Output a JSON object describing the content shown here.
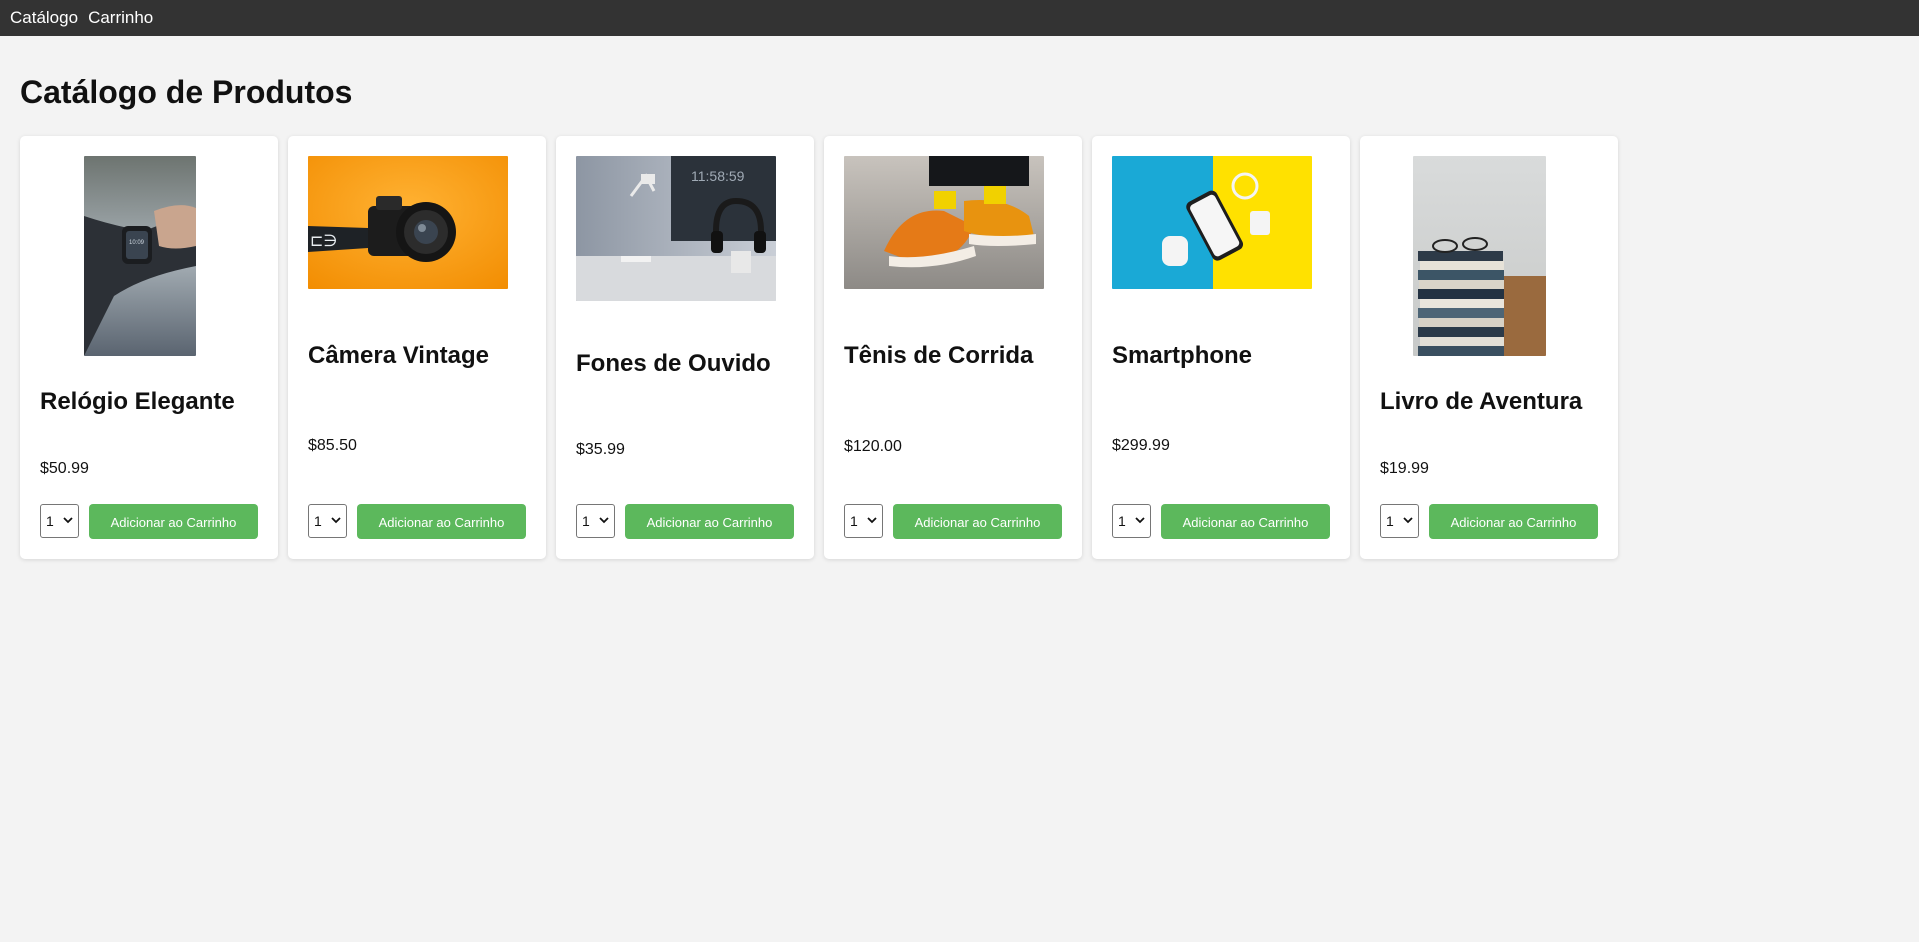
{
  "nav": {
    "items": [
      {
        "label": "Catálogo"
      },
      {
        "label": "Carrinho"
      }
    ]
  },
  "page": {
    "title": "Catálogo de Produtos"
  },
  "products": [
    {
      "name": "Relógio Elegante",
      "price": "$50.99",
      "qty": "1",
      "button": "Adicionar ao Carrinho",
      "image": "smartwatch-photo"
    },
    {
      "name": "Câmera Vintage",
      "price": "$85.50",
      "qty": "1",
      "button": "Adicionar ao Carrinho",
      "image": "camera-photo"
    },
    {
      "name": "Fones de Ouvido",
      "price": "$35.99",
      "qty": "1",
      "button": "Adicionar ao Carrinho",
      "image": "headphones-photo"
    },
    {
      "name": "Tênis de Corrida",
      "price": "$120.00",
      "qty": "1",
      "button": "Adicionar ao Carrinho",
      "image": "sneakers-photo"
    },
    {
      "name": "Smartphone",
      "price": "$299.99",
      "qty": "1",
      "button": "Adicionar ao Carrinho",
      "image": "smartphone-photo"
    },
    {
      "name": "Livro de Aventura",
      "price": "$19.99",
      "qty": "1",
      "button": "Adicionar ao Carrinho",
      "image": "books-photo"
    }
  ],
  "colors": {
    "nav_bg": "#333333",
    "page_bg": "#f3f3f3",
    "button_bg": "#5cb85c"
  }
}
